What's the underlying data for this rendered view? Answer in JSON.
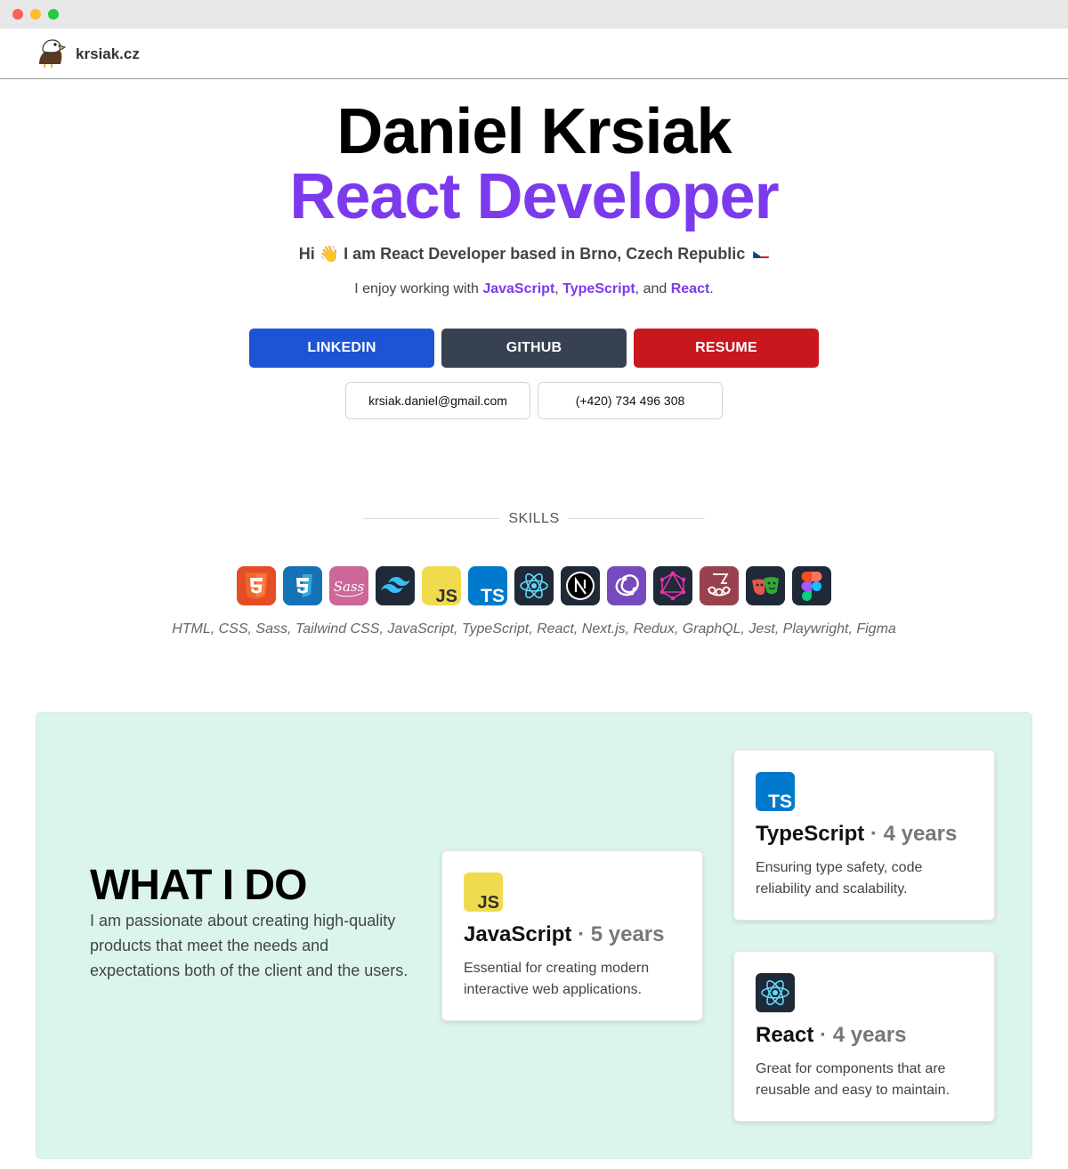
{
  "navbar": {
    "logo_icon": "eagle-icon",
    "site_name": "krsiak.cz"
  },
  "hero": {
    "name": "Daniel Krsiak",
    "role": "React Developer",
    "greeting_start": "Hi",
    "greeting_emoji": "👋",
    "greeting_rest": "I am React Developer based in Brno, Czech Republic",
    "enjoy_prefix": "I enjoy working with",
    "tech_1": "JavaScript",
    "comma_1": ",",
    "tech_2": "TypeScript",
    "and_text": ", and",
    "tech_3": "React",
    "period": ".",
    "accent_color": "#7c3aed"
  },
  "buttons": {
    "linkedin": "LINKEDIN",
    "github": "GITHUB",
    "resume": "RESUME",
    "linkedin_color": "#1d54d6",
    "github_color": "#374151",
    "resume_color": "#c8181e"
  },
  "contact": {
    "email": "krsiak.daniel@gmail.com",
    "phone": "(+420) 734 496 308"
  },
  "skills": {
    "title": "SKILLS",
    "icons": [
      "html5-icon",
      "css3-icon",
      "sass-icon",
      "tailwind-icon",
      "javascript-icon",
      "typescript-icon",
      "react-icon",
      "nextjs-icon",
      "redux-icon",
      "graphql-icon",
      "jest-icon",
      "playwright-icon",
      "figma-icon"
    ],
    "list": "HTML, CSS, Sass, Tailwind CSS, JavaScript, TypeScript, React, Next.js, Redux, GraphQL, Jest, Playwright, Figma"
  },
  "what_i_do": {
    "title": "WHAT I DO",
    "text": "I am passionate about creating high-quality products that meet the needs and expectations both of the client and the users.",
    "cards": [
      {
        "name": "JavaScript",
        "sep": " · ",
        "years": "5 years",
        "desc": "Essential for creating modern interactive web applications.",
        "icon": "javascript-icon"
      },
      {
        "name": "TypeScript",
        "sep": " · ",
        "years": "4 years",
        "desc": "Ensuring type safety, code reliability and scalability.",
        "icon": "typescript-icon"
      },
      {
        "name": "React",
        "sep": " · ",
        "years": "4 years",
        "desc": "Great for components that are reusable and easy to maintain.",
        "icon": "react-icon"
      }
    ],
    "background_color": "#dcf5eb"
  }
}
